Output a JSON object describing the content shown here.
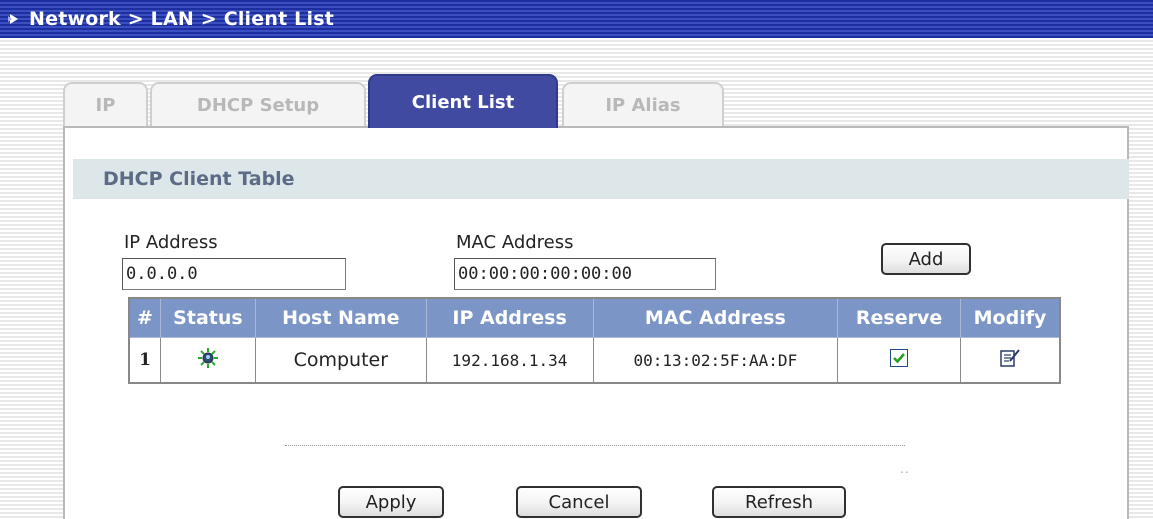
{
  "breadcrumb": "Network > LAN > Client List",
  "tabs": [
    {
      "label": "IP",
      "active": false
    },
    {
      "label": "DHCP Setup",
      "active": false
    },
    {
      "label": "Client List",
      "active": true
    },
    {
      "label": "IP Alias",
      "active": false
    }
  ],
  "section_title": "DHCP Client Table",
  "form": {
    "ip_label": "IP Address",
    "ip_value": "0.0.0.0",
    "mac_label": "MAC Address",
    "mac_value": "00:00:00:00:00:00",
    "add_label": "Add"
  },
  "table": {
    "headers": [
      "#",
      "Status",
      "Host Name",
      "IP Address",
      "MAC Address",
      "Reserve",
      "Modify"
    ],
    "rows": [
      {
        "num": "1",
        "status_icon": "status-online-icon",
        "host": "Computer",
        "ip": "192.168.1.34",
        "mac": "00:13:02:5F:AA:DF",
        "reserve": true,
        "modify_icon": "edit-icon"
      }
    ]
  },
  "buttons": {
    "apply": "Apply",
    "cancel": "Cancel",
    "refresh": "Refresh"
  },
  "colors": {
    "title_bar": "#1d2f9e",
    "active_tab": "#3f4aa0",
    "table_header": "#7b95c6",
    "section_header_bg": "#dde6e8"
  }
}
